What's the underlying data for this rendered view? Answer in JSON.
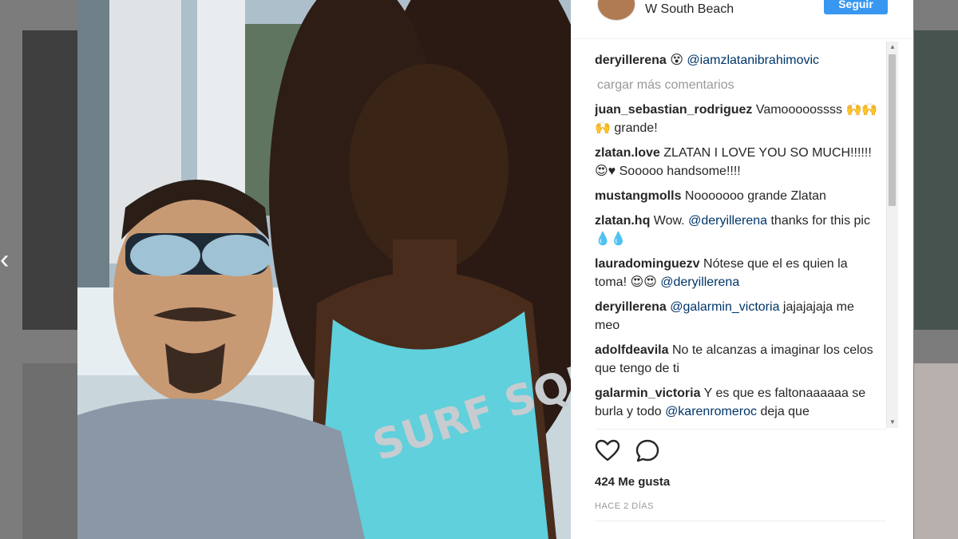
{
  "header": {
    "location": "W South Beach",
    "follow_label": "Seguir"
  },
  "caption": {
    "user": "deryillerena",
    "emoji": "😵",
    "mention": "@iamzlatanibrahimovic"
  },
  "load_more_label": "cargar más comentarios",
  "comments": [
    {
      "user": "juan_sebastian_rodriguez",
      "text": "Vamooooossss 🙌🙌🙌 grande!"
    },
    {
      "user": "zlatan.love",
      "text": "ZLATAN I LOVE YOU SO MUCH!!!!!! 😍♥ Sooooo handsome!!!!"
    },
    {
      "user": "mustangmolls",
      "text": "Nooooooo grande Zlatan"
    },
    {
      "user": "zlatan.hq",
      "pre": "Wow. ",
      "mention": "@deryillerena",
      "post": " thanks for this pic💧💧"
    },
    {
      "user": "lauradominguezv",
      "pre": "Nótese que el es quien la toma! 😍😍 ",
      "mention": "@deryillerena",
      "post": ""
    },
    {
      "user": "deryillerena",
      "pre": "",
      "mention": "@galarmin_victoria",
      "post": " jajajajaja me meo"
    },
    {
      "user": "adolfdeavila",
      "text": "No te alcanzas a imaginar los celos que tengo de ti"
    },
    {
      "user": "galarmin_victoria",
      "pre": "Y es que es faltonaaaaaa se burla y todo ",
      "mention": "@karenromeroc",
      "post": " deja que"
    }
  ],
  "likes": "424 Me gusta",
  "timestamp": "HACE 2 DÍAS",
  "nav": {
    "prev_icon": "‹"
  },
  "photo_text": "SURF SQUAD",
  "colors": {
    "accent": "#3897f0",
    "mention": "#003569",
    "muted": "#999999"
  }
}
